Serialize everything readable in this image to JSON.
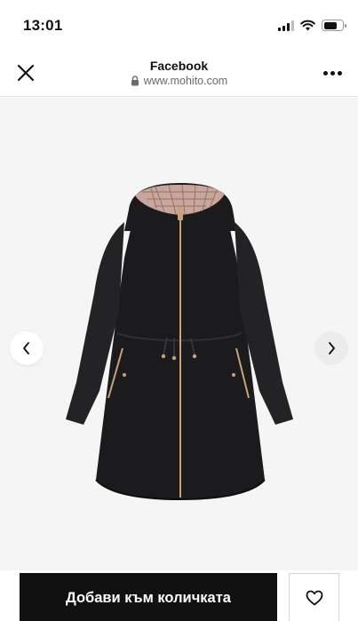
{
  "status_bar": {
    "time": "13:01",
    "signal_icon": "cellular-signal-icon",
    "wifi_icon": "wifi-icon",
    "battery_icon": "battery-icon",
    "battery_level": 0.7
  },
  "browser": {
    "title": "Facebook",
    "url": "www.mohito.com",
    "close_icon": "close-icon",
    "lock_icon": "lock-icon",
    "more_icon": "more-options-icon"
  },
  "product": {
    "image_alt": "black hooded parka",
    "prev_icon": "chevron-left-icon",
    "next_icon": "chevron-right-icon"
  },
  "actions": {
    "add_to_cart_label": "Добави към количката",
    "wishlist_icon": "heart-icon"
  },
  "colors": {
    "accent": "#111111",
    "image_background": "#f5f5f5",
    "coat": "#1b1b1d",
    "zipper": "#c9a27a"
  }
}
